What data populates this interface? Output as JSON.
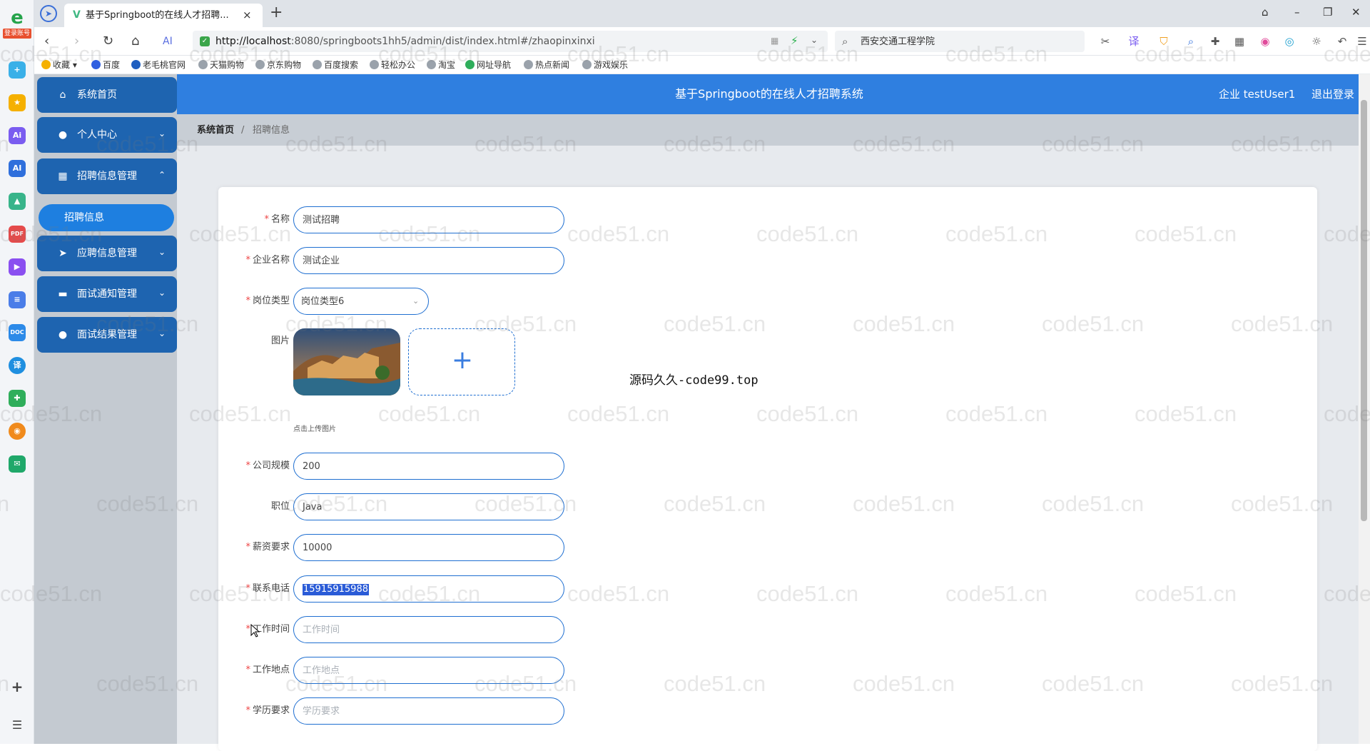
{
  "browser": {
    "tab_title": "基于Springboot的在线人才招聘...",
    "tab_close": "×",
    "new_tab": "+",
    "url_host": "http://localhost",
    "url_rest": ":8080/springboots1hh5/admin/dist/index.html#/zhaopinxinxi",
    "search_text": "西安交通工程学院",
    "bookmarks": [
      "收藏",
      "百度",
      "老毛桃官网",
      "天猫购物",
      "京东购物",
      "百度搜索",
      "轻松办公",
      "淘宝",
      "网址导航",
      "热点新闻",
      "游戏娱乐"
    ],
    "dock_tag": "登录账号"
  },
  "sidebar": {
    "items": [
      {
        "label": "系统首页",
        "icon": "home-icon"
      },
      {
        "label": "个人中心",
        "icon": "user-icon"
      },
      {
        "label": "招聘信息管理",
        "icon": "grid-icon"
      },
      {
        "label": "应聘信息管理",
        "icon": "send-icon"
      },
      {
        "label": "面试通知管理",
        "icon": "briefcase-icon"
      },
      {
        "label": "面试结果管理",
        "icon": "pin-icon"
      }
    ],
    "active_sub": "招聘信息"
  },
  "header": {
    "title": "基于Springboot的在线人才招聘系统",
    "user": "企业 testUser1",
    "logout": "退出登录"
  },
  "breadcrumb": {
    "home": "系统首页",
    "sep": "/",
    "current": "招聘信息"
  },
  "form": {
    "name_label": "名称",
    "name_value": "测试招聘",
    "company_label": "企业名称",
    "company_value": "测试企业",
    "type_label": "岗位类型",
    "type_value": "岗位类型6",
    "image_label": "图片",
    "upload_hint": "点击上传图片",
    "upload_plus": "+",
    "size_label": "公司规模",
    "size_value": "200",
    "position_label": "职位",
    "position_value": "Java",
    "salary_label": "薪资要求",
    "salary_value": "10000",
    "phone_label": "联系电话",
    "phone_value": "15915915988",
    "worktime_label": "工作时间",
    "worktime_placeholder": "工作时间",
    "location_label": "工作地点",
    "location_placeholder": "工作地点",
    "education_label": "学历要求",
    "education_placeholder": "学历要求"
  },
  "overlay_text": "源码久久-code99.top",
  "watermark": "code51.cn"
}
